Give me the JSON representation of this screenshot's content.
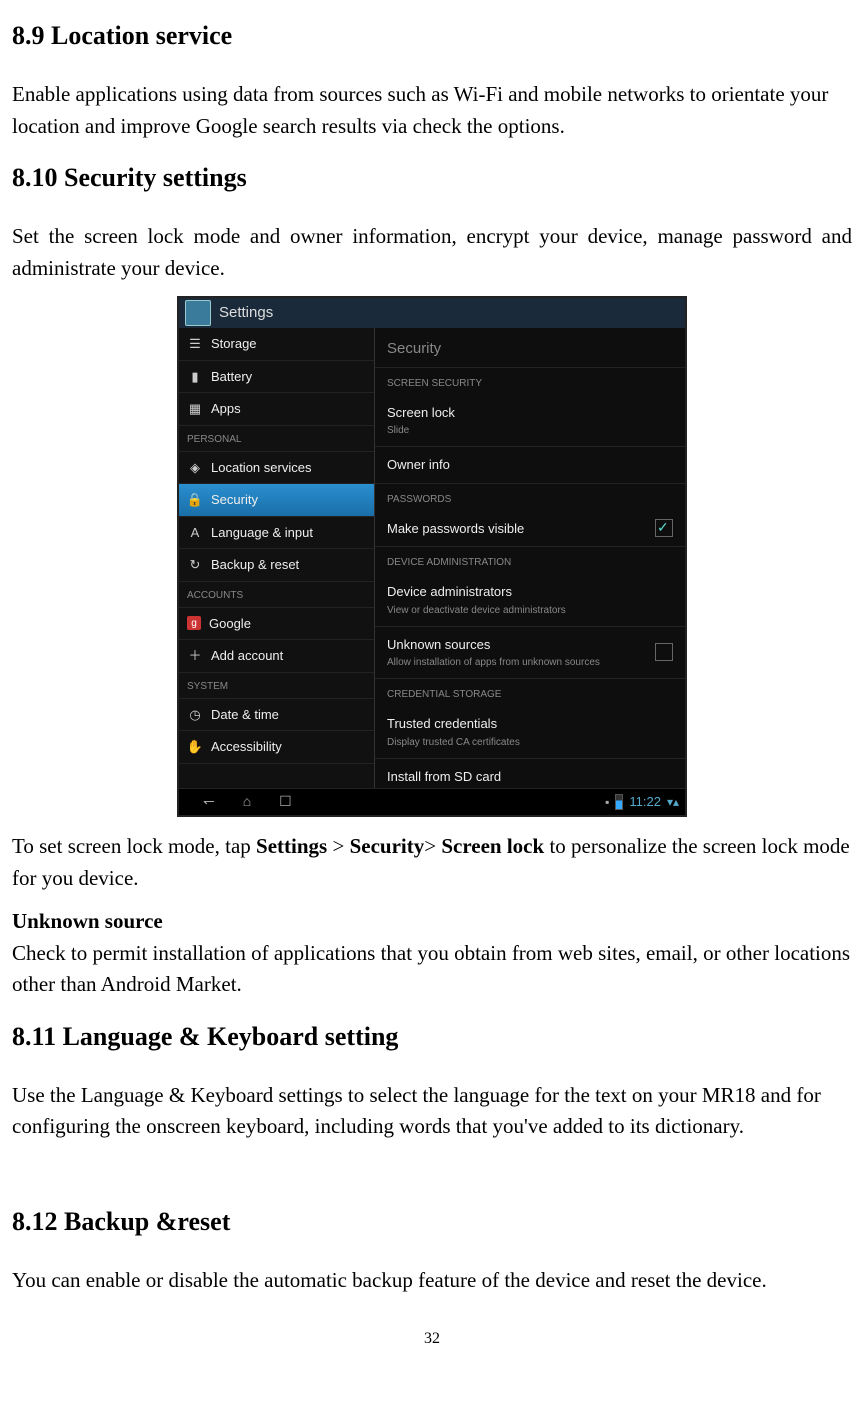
{
  "sections": {
    "s89": {
      "heading": "8.9 Location service",
      "body": "Enable applications using data from sources such as Wi-Fi and mobile networks to orientate your location and improve Google search results via check the options."
    },
    "s810": {
      "heading": "8.10 Security settings",
      "body": "Set the screen lock mode and owner information, encrypt your device, manage password and administrate your device.",
      "after_pre": "To set screen lock mode, tap ",
      "bold1": "Settings",
      "gt1": " > ",
      "bold2": "Security",
      "gt2": "> ",
      "bold3": "Screen lock",
      "after_post": " to personalize the screen lock mode for you device.",
      "unknown_label": "Unknown source",
      "unknown_body": "Check to permit installation of applications that you obtain from web sites, email, or other locations other than Android Market."
    },
    "s811": {
      "heading": "8.11 Language & Keyboard setting",
      "body": "Use the Language & Keyboard settings to select the language for the text on your MR18 and for configuring the onscreen keyboard, including words that you've added to its dictionary."
    },
    "s812": {
      "heading": "8.12 Backup &reset",
      "body": "You can enable or disable the automatic backup feature of the device and reset the device."
    }
  },
  "page_number": "32",
  "screenshot": {
    "status_title": "Settings",
    "nav": {
      "storage": "Storage",
      "battery": "Battery",
      "apps": "Apps",
      "cat_personal": "PERSONAL",
      "location": "Location services",
      "security": "Security",
      "language": "Language & input",
      "backup": "Backup & reset",
      "cat_accounts": "ACCOUNTS",
      "google": "Google",
      "add_account": "Add account",
      "cat_system": "SYSTEM",
      "datetime": "Date & time",
      "accessibility": "Accessibility"
    },
    "right": {
      "title": "Security",
      "cat_screen": "SCREEN SECURITY",
      "screen_lock": "Screen lock",
      "screen_lock_sub": "Slide",
      "owner_info": "Owner info",
      "cat_passwords": "PASSWORDS",
      "make_visible": "Make passwords visible",
      "cat_admin": "DEVICE ADMINISTRATION",
      "device_admin": "Device administrators",
      "device_admin_sub": "View or deactivate device administrators",
      "unknown": "Unknown sources",
      "unknown_sub": "Allow installation of apps from unknown sources",
      "cat_cred": "CREDENTIAL STORAGE",
      "trusted": "Trusted credentials",
      "trusted_sub": "Display trusted CA certificates",
      "install_sd": "Install from SD card"
    },
    "time": "11:22"
  }
}
